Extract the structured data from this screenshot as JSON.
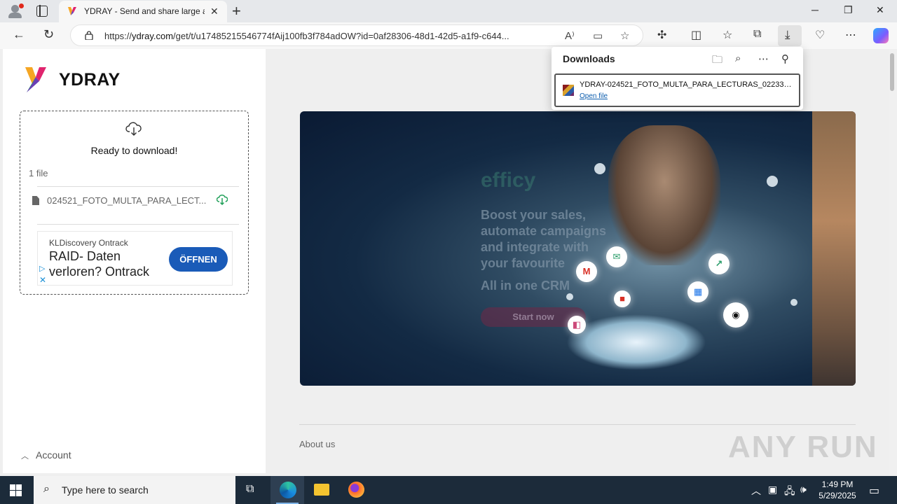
{
  "browser": {
    "tab_title": "YDRAY - Send and share large and",
    "url_prefix": "https://",
    "url_domain": "ydray.com",
    "url_path": "/get/t/u17485215546774fAij100fb3f784adOW?id=0af28306-48d1-42d5-a1f9-c644...",
    "window_controls": {
      "minimize": "─",
      "restore": "❐",
      "close": "✕"
    }
  },
  "downloads": {
    "title": "Downloads",
    "item_name": "YDRAY-024521_FOTO_MULTA_PARA_LECTURAS_0223365...",
    "open_link": "Open file"
  },
  "sidebar": {
    "brand": "YDRAY",
    "ready_text": "Ready to download!",
    "file_count": "1 file",
    "file_name": "024521_FOTO_MULTA_PARA_LECT...",
    "account": "Account"
  },
  "ad": {
    "advertiser": "KLDiscovery Ontrack",
    "headline": "RAID- Daten verloren? Ontrack",
    "button": "ÖFFNEN"
  },
  "banner": {
    "brand": "efficy",
    "line1": "Boost your sales,",
    "line2": "automate campaigns",
    "line3": "and integrate with",
    "line4": "your favourite",
    "tagline": "All in one CRM",
    "button": "Start now"
  },
  "footer": {
    "about": "About us",
    "watermark": "ANY RUN"
  },
  "taskbar": {
    "search_placeholder": "Type here to search",
    "time": "1:49 PM",
    "date": "5/29/2025"
  },
  "colors": {
    "ad_button": "#1a5bb8",
    "taskbar": "#1c2b3a",
    "download_green": "#22a05a"
  }
}
